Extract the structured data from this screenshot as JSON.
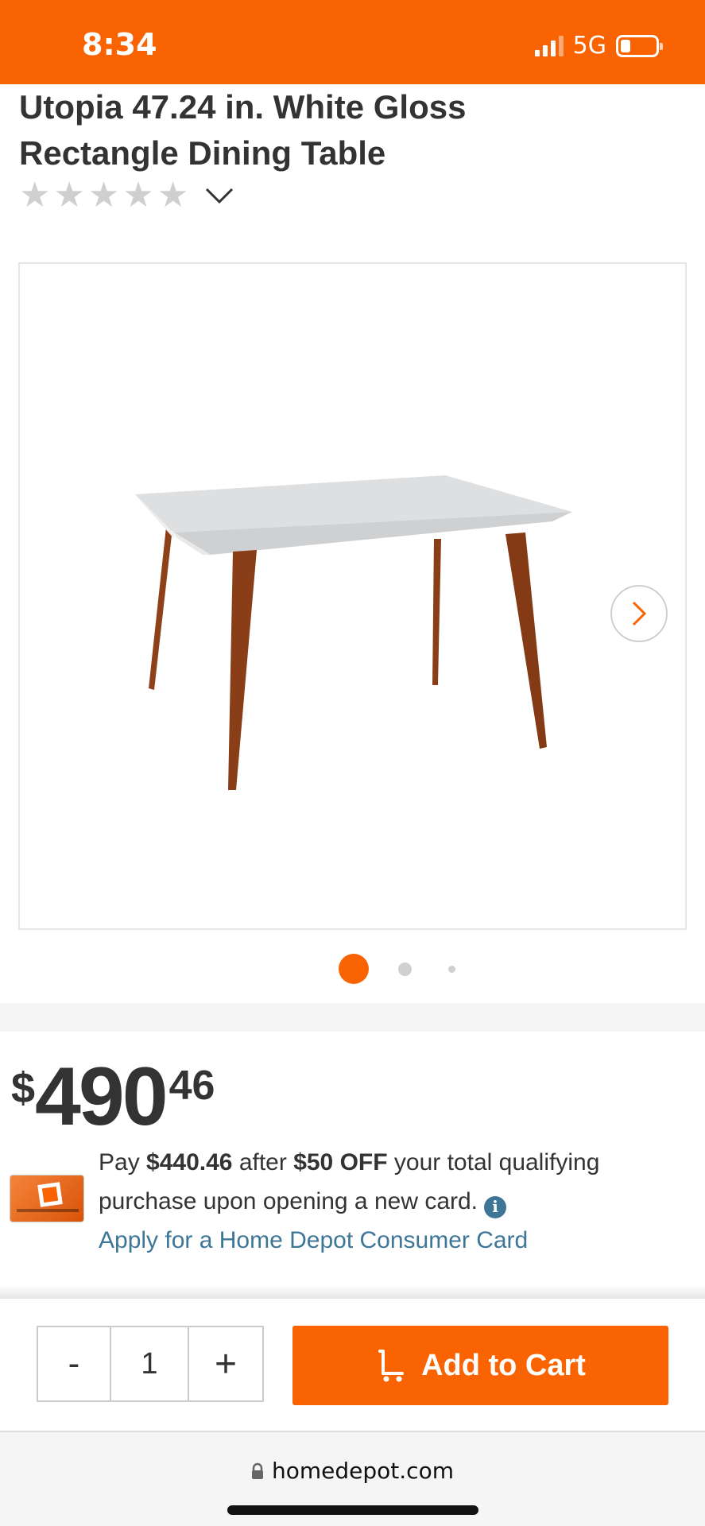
{
  "status_bar": {
    "time": "8:34",
    "network": "5G",
    "signal_bars_active": 3,
    "signal_bars_total": 4,
    "battery_level_fraction": 0.25
  },
  "product": {
    "title": "Utopia 47.24 in. White Gloss Rectangle Dining Table",
    "rating_stars_filled": 0,
    "rating_stars_total": 5,
    "image_icon": "dining-table-photo",
    "next_icon": "chevron-right-icon",
    "gallery_current_index": 1,
    "gallery_dot_count": 3
  },
  "price": {
    "currency": "$",
    "dollars": "490",
    "cents": "46"
  },
  "promo": {
    "pay_prefix": "Pay ",
    "promo_price": "$440.46",
    "after_text": " after ",
    "discount": "$50 OFF",
    "rest_text": " your total qualifying purchase upon opening a new card.",
    "info_glyph": "i",
    "apply_link": "Apply for a Home Depot Consumer Card"
  },
  "cart": {
    "minus_label": "-",
    "quantity": "1",
    "plus_label": "+",
    "add_to_cart_label": "Add to Cart"
  },
  "browser": {
    "url": "homedepot.com"
  },
  "colors": {
    "brand_orange": "#f96302",
    "link_blue": "#3e7697",
    "text_dark": "#333333",
    "star_gray": "#cfcfcf",
    "table_leg_brown": "#8a3e18"
  }
}
